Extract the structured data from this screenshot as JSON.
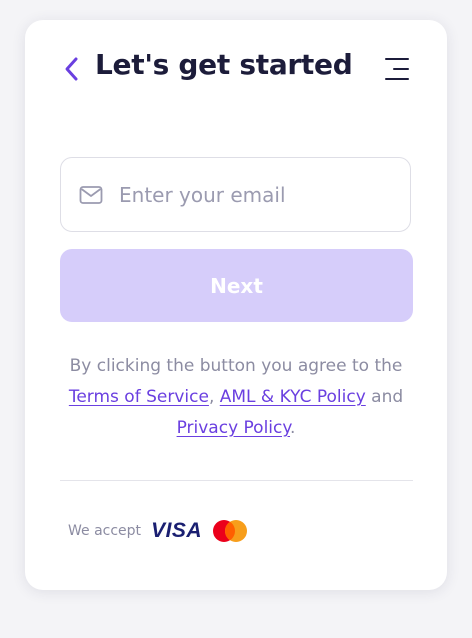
{
  "header": {
    "title": "Let's get started"
  },
  "form": {
    "email_placeholder": "Enter your email",
    "email_value": "",
    "next_label": "Next"
  },
  "consent": {
    "line_prefix": "By clicking the button you agree to the ",
    "terms_label": "Terms of Service",
    "sep1": ", ",
    "aml_label": "AML & KYC Policy",
    "sep2": " and ",
    "privacy_label": "Privacy Policy",
    "suffix": "."
  },
  "payments": {
    "accept_label": "We accept",
    "visa_label": "VISA",
    "icons": [
      "visa-logo",
      "mastercard-logo"
    ]
  },
  "colors": {
    "accent": "#6a3fe0",
    "button_disabled": "#d6cdfa",
    "title": "#1c1c3a",
    "muted_text": "#8c8ca2"
  }
}
